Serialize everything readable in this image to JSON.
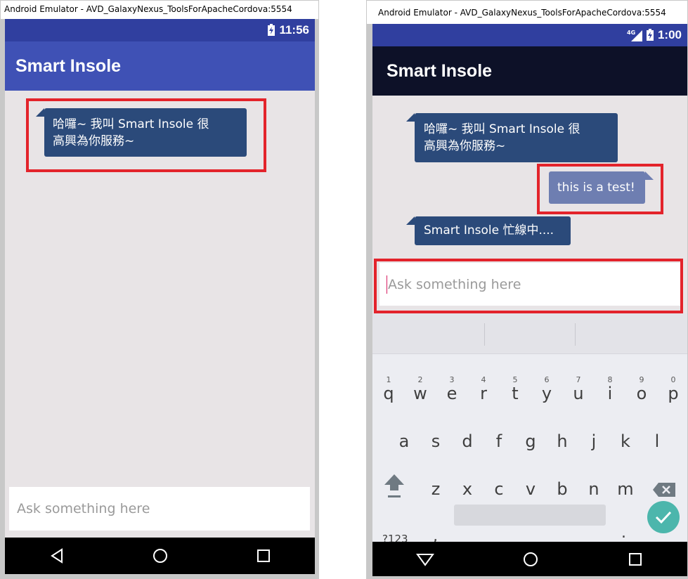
{
  "left_window": {
    "title": "Android Emulator - AVD_GalaxyNexus_ToolsForApacheCordova:5554",
    "status_time": "11:56",
    "app_title": "Smart Insole",
    "messages": [
      {
        "from": "bot",
        "text_line1": "哈囉~ 我叫 Smart Insole 很",
        "text_line2": "高興為你服務~"
      }
    ],
    "input_placeholder": "Ask something here"
  },
  "right_window": {
    "title": "Android Emulator - AVD_GalaxyNexus_ToolsForApacheCordova:5554",
    "status_network": "4G",
    "status_time": "1:00",
    "app_title": "Smart Insole",
    "messages": [
      {
        "from": "bot",
        "text_line1": "哈囉~ 我叫 Smart Insole 很",
        "text_line2": "高興為你服務~"
      },
      {
        "from": "user",
        "text": "this is a test!"
      },
      {
        "from": "bot",
        "text": "Smart Insole 忙線中...."
      }
    ],
    "input_placeholder": "Ask something here",
    "keyboard": {
      "row1": [
        {
          "num": "1",
          "ch": "q"
        },
        {
          "num": "2",
          "ch": "w"
        },
        {
          "num": "3",
          "ch": "e"
        },
        {
          "num": "4",
          "ch": "r"
        },
        {
          "num": "5",
          "ch": "t"
        },
        {
          "num": "6",
          "ch": "y"
        },
        {
          "num": "7",
          "ch": "u"
        },
        {
          "num": "8",
          "ch": "i"
        },
        {
          "num": "9",
          "ch": "o"
        },
        {
          "num": "0",
          "ch": "p"
        }
      ],
      "row2": [
        "a",
        "s",
        "d",
        "f",
        "g",
        "h",
        "j",
        "k",
        "l"
      ],
      "row3": [
        "z",
        "x",
        "c",
        "v",
        "b",
        "n",
        "m"
      ],
      "symbols_label": "?123",
      "comma": ",",
      "period": "."
    }
  },
  "colors": {
    "left_status_bar": "#303f9f",
    "left_app_bar": "#3f51b5",
    "right_status_bar": "#303f9f",
    "right_app_bar": "#0d1128",
    "bot_bubble": "#2b4a7a",
    "user_bubble": "#6e7eb1",
    "highlight": "#e3232b",
    "enter_key": "#4cb6ac"
  }
}
